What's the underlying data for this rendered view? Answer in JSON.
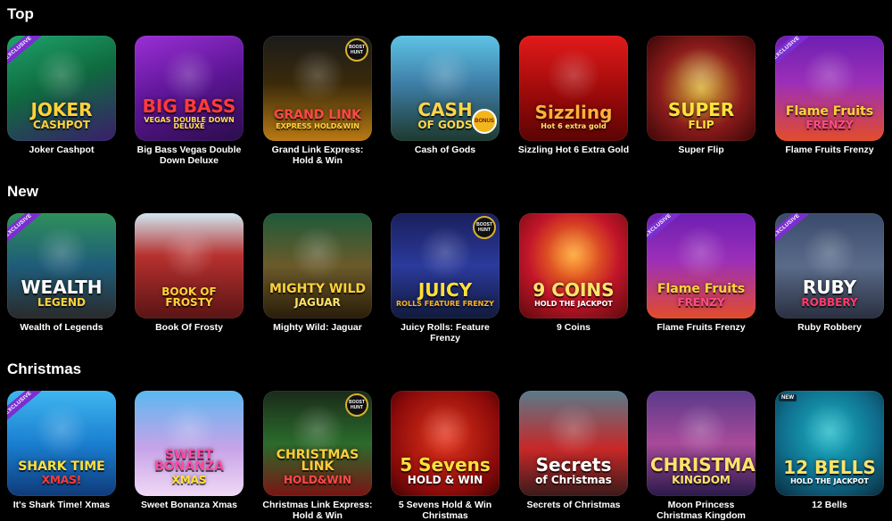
{
  "sections": [
    {
      "title": "Top",
      "games": [
        {
          "name": "Joker Cashpot",
          "art_l1": "JOKER",
          "art_l2": "CASHPOT",
          "bg": "linear-gradient(160deg,#1fa36a 0%,#0f6b3f 45%,#3a1d6b 100%)",
          "l1color": "#ffd23a",
          "l2color": "#ffd23a",
          "badge": "exclusive"
        },
        {
          "name": "Big Bass Vegas Double Down Deluxe",
          "art_l1": "BIG BASS",
          "art_l2": "VEGAS DOUBLE DOWN DELUXE",
          "bg": "linear-gradient(160deg,#9b2fd6 0%,#5b1594 50%,#2a0d4b 100%)",
          "l1color": "#ff3b3b",
          "l2color": "#ffe04a",
          "badge": ""
        },
        {
          "name": "Grand Link Express: Hold & Win",
          "art_l1": "GRAND LINK",
          "art_l2": "EXPRESS HOLD&WIN",
          "bg": "linear-gradient(180deg,#1b1b1b 0%,#3a2a0a 45%,#b97a13 100%)",
          "l1color": "#ff4848",
          "l2color": "#ffcf3a",
          "badge": "hunt"
        },
        {
          "name": "Cash of Gods",
          "art_l1": "CASH",
          "art_l2": "OF GODS",
          "bg": "linear-gradient(180deg,#5ec3e6 0%,#3f7fa8 45%,#1d3a2f 100%)",
          "l1color": "#ffd646",
          "l2color": "#ffd646",
          "badge": "bonus"
        },
        {
          "name": "Sizzling Hot 6 Extra Gold",
          "art_l1": "Sizzling",
          "art_l2": "Hot 6 extra gold",
          "bg": "linear-gradient(180deg,#e21a1a 0%,#9c0a0a 55%,#5c0404 100%)",
          "l1color": "#ffb13a",
          "l2color": "#ffe36b",
          "badge": ""
        },
        {
          "name": "Super Flip",
          "art_l1": "SUPER",
          "art_l2": "FLIP",
          "bg": "radial-gradient(circle at 50% 50%,#d8b23a 0%,#8a1b1b 55%,#3a0606 100%)",
          "l1color": "#ffe23a",
          "l2color": "#ffe23a",
          "badge": ""
        },
        {
          "name": "Flame Fruits Frenzy",
          "art_l1": "Flame Fruits",
          "art_l2": "FRENZY",
          "bg": "linear-gradient(180deg,#6d1fb3 0%,#9c2fb8 45%,#e24c2a 100%)",
          "l1color": "#ffd23a",
          "l2color": "#ff4a8a",
          "badge": "exclusive"
        }
      ]
    },
    {
      "title": "New",
      "games": [
        {
          "name": "Wealth of Legends",
          "art_l1": "WEALTH",
          "art_l2": "LEGEND",
          "bg": "linear-gradient(180deg,#2f8f5a 0%,#1e5c7a 50%,#2a2a2a 100%)",
          "l1color": "#ffffff",
          "l2color": "#ffd23a",
          "badge": "exclusive"
        },
        {
          "name": "Book Of Frosty",
          "art_l1": "",
          "art_l2": "BOOK OF FROSTY",
          "bg": "linear-gradient(180deg,#cfe7f2 0%,#b7312f 40%,#5a1414 100%)",
          "l1color": "#ffffff",
          "l2color": "#ffd23a",
          "badge": ""
        },
        {
          "name": "Mighty Wild: Jaguar",
          "art_l1": "MIGHTY WILD",
          "art_l2": "JAGUAR",
          "bg": "linear-gradient(180deg,#1d5a3a 0%,#6b5a2a 50%,#2a1d0a 100%)",
          "l1color": "#ffd23a",
          "l2color": "#ffe36b",
          "badge": ""
        },
        {
          "name": "Juicy Rolls: Feature Frenzy",
          "art_l1": "JUICY",
          "art_l2": "ROLLS FEATURE FRENZY",
          "bg": "linear-gradient(180deg,#1a1f5c 0%,#2b3a9c 50%,#111a3a 100%)",
          "l1color": "#ffe03a",
          "l2color": "#ffb21a",
          "badge": "hunt"
        },
        {
          "name": "9 Coins",
          "art_l1": "9 COINS",
          "art_l2": "HOLD THE JACKPOT",
          "bg": "radial-gradient(circle at 50% 40%,#ff9b1a 0%,#c2152a 55%,#5a0a0a 100%)",
          "l1color": "#ffe36b",
          "l2color": "#ffffff",
          "badge": ""
        },
        {
          "name": "Flame Fruits Frenzy",
          "art_l1": "Flame Fruits",
          "art_l2": "FRENZY",
          "bg": "linear-gradient(180deg,#6d1fb3 0%,#9c2fb8 45%,#e24c2a 100%)",
          "l1color": "#ffd23a",
          "l2color": "#ff4a8a",
          "badge": "exclusive"
        },
        {
          "name": "Ruby Robbery",
          "art_l1": "RUBY",
          "art_l2": "ROBBERY",
          "bg": "linear-gradient(180deg,#3a4a6b 0%,#5a6b8a 50%,#2a3040 100%)",
          "l1color": "#ffffff",
          "l2color": "#ff3b6b",
          "badge": "exclusive"
        }
      ]
    },
    {
      "title": "Christmas",
      "games": [
        {
          "name": "It's Shark Time! Xmas",
          "art_l1": "SHARK TIME",
          "art_l2": "XMAS!",
          "bg": "linear-gradient(180deg,#3fb6f0 0%,#1a7fd0 50%,#0f3a7a 100%)",
          "l1color": "#ffe03a",
          "l2color": "#ff3b3b",
          "badge": "exclusive"
        },
        {
          "name": "Sweet Bonanza Xmas",
          "art_l1": "SWEET BONANZA",
          "art_l2": "XMAS",
          "bg": "linear-gradient(180deg,#5bb8f0 0%,#c7a3e8 55%,#f0d9f5 100%)",
          "l1color": "#ff4aa8",
          "l2color": "#ffe03a",
          "badge": ""
        },
        {
          "name": "Christmas Link Express: Hold & Win",
          "art_l1": "CHRISTMAS LINK",
          "art_l2": "HOLD&WIN",
          "bg": "linear-gradient(180deg,#1a2a1a 0%,#2b6b2b 50%,#7a1414 100%)",
          "l1color": "#ffcf3a",
          "l2color": "#ff4848",
          "badge": "hunt"
        },
        {
          "name": "5 Sevens Hold & Win Christmas",
          "art_l1": "5 Sevens",
          "art_l2": "HOLD & WIN",
          "bg": "radial-gradient(circle at 50% 45%,#e2331a 0%,#8a0a0a 70%,#3a0404 100%)",
          "l1color": "#ffe03a",
          "l2color": "#ffffff",
          "badge": ""
        },
        {
          "name": "Secrets of Christmas",
          "art_l1": "Secrets",
          "art_l2": "of Christmas",
          "bg": "linear-gradient(180deg,#5a7a8a 0%,#c72828 55%,#3a1a1a 100%)",
          "l1color": "#ffffff",
          "l2color": "#ffffff",
          "badge": ""
        },
        {
          "name": "Moon Princess Christmas Kingdom",
          "art_l1": "CHRISTMAS",
          "art_l2": "KINGDOM",
          "bg": "linear-gradient(180deg,#5a3a8a 0%,#a84a9a 50%,#2a1a4a 100%)",
          "l1color": "#ffe36b",
          "l2color": "#ffe36b",
          "badge": ""
        },
        {
          "name": "12 Bells",
          "art_l1": "12 BELLS",
          "art_l2": "HOLD THE JACKPOT",
          "bg": "radial-gradient(circle at 50% 40%,#1ab6c7 0%,#0f6b8a 60%,#0a2a3a 100%)",
          "l1color": "#ffe36b",
          "l2color": "#ffffff",
          "badge": "new"
        }
      ]
    }
  ],
  "badges": {
    "exclusive": "EXCLUSIVE",
    "hunt": "BOOST HUNT",
    "bonus": "BONUS",
    "new": "NEW"
  },
  "colors": {
    "background": "#000000",
    "text": "#ffffff"
  }
}
